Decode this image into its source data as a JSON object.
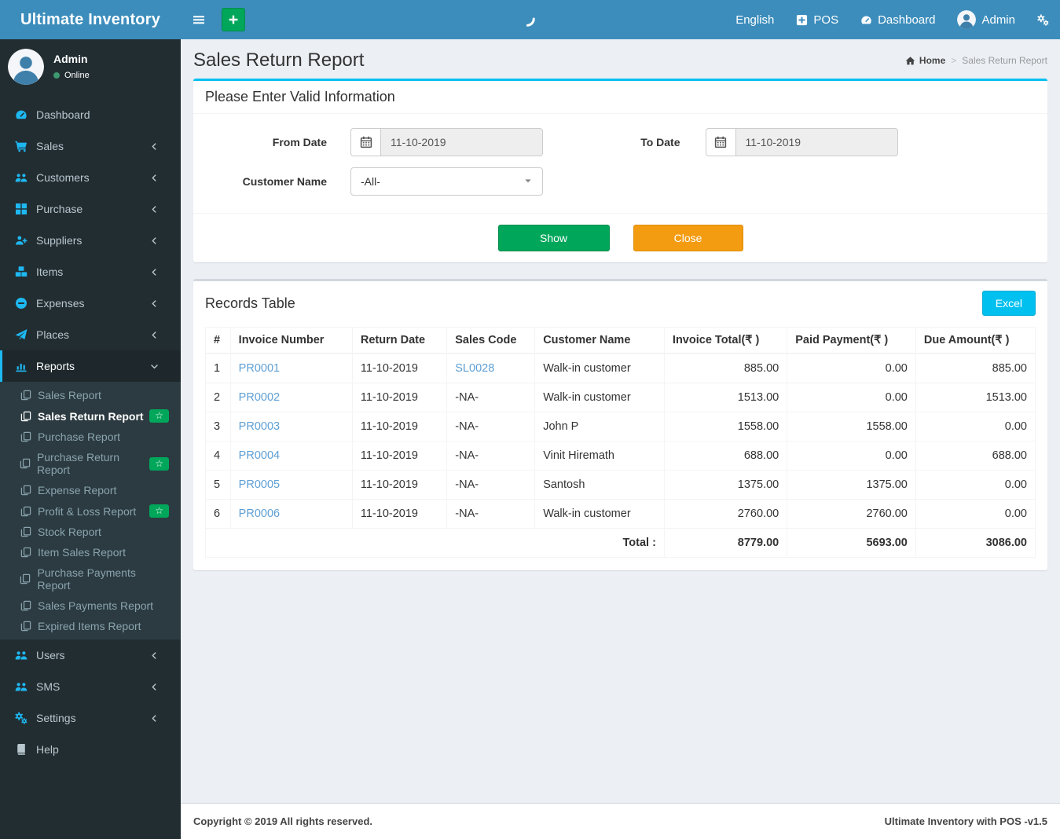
{
  "header": {
    "brand": "Ultimate Inventory",
    "nav": {
      "language": "English",
      "pos": "POS",
      "dashboard": "Dashboard",
      "user": "Admin"
    }
  },
  "sidebar": {
    "user": {
      "name": "Admin",
      "status": "Online"
    },
    "items": [
      {
        "label": "Dashboard",
        "icon": "dashboard-icon",
        "chevron": false
      },
      {
        "label": "Sales",
        "icon": "cart-icon",
        "chevron": "left"
      },
      {
        "label": "Customers",
        "icon": "users-icon",
        "chevron": "left"
      },
      {
        "label": "Purchase",
        "icon": "grid-icon",
        "chevron": "left"
      },
      {
        "label": "Suppliers",
        "icon": "user-plus-icon",
        "chevron": "left"
      },
      {
        "label": "Items",
        "icon": "cubes-icon",
        "chevron": "left"
      },
      {
        "label": "Expenses",
        "icon": "minus-circle-icon",
        "chevron": "left"
      },
      {
        "label": "Places",
        "icon": "paper-plane-icon",
        "chevron": "left"
      },
      {
        "label": "Reports",
        "icon": "bar-chart-icon",
        "chevron": "down",
        "active": true,
        "submenu": [
          {
            "label": "Sales Report"
          },
          {
            "label": "Sales Return Report",
            "active": true,
            "badge": "star"
          },
          {
            "label": "Purchase Report"
          },
          {
            "label": "Purchase Return Report",
            "badge": "star"
          },
          {
            "label": "Expense Report"
          },
          {
            "label": "Profit & Loss Report",
            "badge": "star"
          },
          {
            "label": "Stock Report"
          },
          {
            "label": "Item Sales Report"
          },
          {
            "label": "Purchase Payments Report"
          },
          {
            "label": "Sales Payments Report"
          },
          {
            "label": "Expired Items Report"
          }
        ]
      },
      {
        "label": "Users",
        "icon": "users-icon",
        "chevron": "left"
      },
      {
        "label": "SMS",
        "icon": "users-icon",
        "chevron": "left"
      },
      {
        "label": "Settings",
        "icon": "gears-icon",
        "chevron": "left"
      },
      {
        "label": "Help",
        "icon": "book-icon",
        "chevron": false,
        "muted_icon": true
      }
    ]
  },
  "page": {
    "title": "Sales Return Report",
    "breadcrumb_home": "Home",
    "breadcrumb_separator": ">",
    "breadcrumb_current": "Sales Return Report"
  },
  "filter": {
    "panel_title": "Please Enter Valid Information",
    "from_date_label": "From Date",
    "from_date_value": "11-10-2019",
    "to_date_label": "To Date",
    "to_date_value": "11-10-2019",
    "customer_label": "Customer Name",
    "customer_value": "-All-",
    "show_label": "Show",
    "close_label": "Close"
  },
  "records": {
    "panel_title": "Records Table",
    "excel_label": "Excel",
    "columns": [
      "#",
      "Invoice Number",
      "Return Date",
      "Sales Code",
      "Customer Name",
      "Invoice Total(₹ )",
      "Paid Payment(₹ )",
      "Due Amount(₹ )"
    ],
    "rows": [
      {
        "num": "1",
        "invoice": "PR0001",
        "date": "11-10-2019",
        "code": "SL0028",
        "code_link": true,
        "customer": "Walk-in customer",
        "total": "885.00",
        "paid": "0.00",
        "due": "885.00"
      },
      {
        "num": "2",
        "invoice": "PR0002",
        "date": "11-10-2019",
        "code": "-NA-",
        "code_link": false,
        "customer": "Walk-in customer",
        "total": "1513.00",
        "paid": "0.00",
        "due": "1513.00"
      },
      {
        "num": "3",
        "invoice": "PR0003",
        "date": "11-10-2019",
        "code": "-NA-",
        "code_link": false,
        "customer": "John P",
        "total": "1558.00",
        "paid": "1558.00",
        "due": "0.00"
      },
      {
        "num": "4",
        "invoice": "PR0004",
        "date": "11-10-2019",
        "code": "-NA-",
        "code_link": false,
        "customer": "Vinit Hiremath",
        "total": "688.00",
        "paid": "0.00",
        "due": "688.00"
      },
      {
        "num": "5",
        "invoice": "PR0005",
        "date": "11-10-2019",
        "code": "-NA-",
        "code_link": false,
        "customer": "Santosh",
        "total": "1375.00",
        "paid": "1375.00",
        "due": "0.00"
      },
      {
        "num": "6",
        "invoice": "PR0006",
        "date": "11-10-2019",
        "code": "-NA-",
        "code_link": false,
        "customer": "Walk-in customer",
        "total": "2760.00",
        "paid": "2760.00",
        "due": "0.00"
      }
    ],
    "total_label": "Total :",
    "totals": [
      "8779.00",
      "5693.00",
      "3086.00"
    ]
  },
  "footer": {
    "left": "Copyright © 2019 All rights reserved.",
    "right": "Ultimate Inventory with POS -v1.5"
  },
  "colors": {
    "header_blue": "#3c8dbc",
    "sidebar_dark": "#222d32",
    "submenu_dark": "#2c3b41",
    "icon_cyan": "#1eb8f1",
    "green": "#00a65a",
    "orange": "#f39c12",
    "cyan": "#00c0ef",
    "body_bg": "#ecf0f5",
    "link_blue": "#5e9fd4"
  }
}
